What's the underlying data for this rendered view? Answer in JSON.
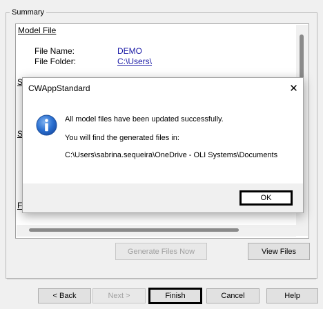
{
  "summary": {
    "group_label": "Summary",
    "model_file_heading": "Model File",
    "file_name_label": "File Name:",
    "file_name_value": "DEMO",
    "file_folder_label": "File Folder:",
    "file_folder_value": "C:\\Users\\",
    "fragments": [
      "S",
      "S",
      "F"
    ]
  },
  "dialog": {
    "title": "CWAppStandard",
    "close_glyph": "✕",
    "line1": "All model files have been updated successfully.",
    "line2": "You will find the generated files in:",
    "line3": "C:\\Users\\sabrina.sequeira\\OneDrive - OLI Systems\\Documents",
    "ok_label": "OK",
    "icon": "info-icon"
  },
  "buttons": {
    "generate": "Generate Files Now",
    "view": "View Files"
  },
  "footer": {
    "back": "< Back",
    "next": "Next >",
    "finish": "Finish",
    "cancel": "Cancel",
    "help": "Help"
  }
}
